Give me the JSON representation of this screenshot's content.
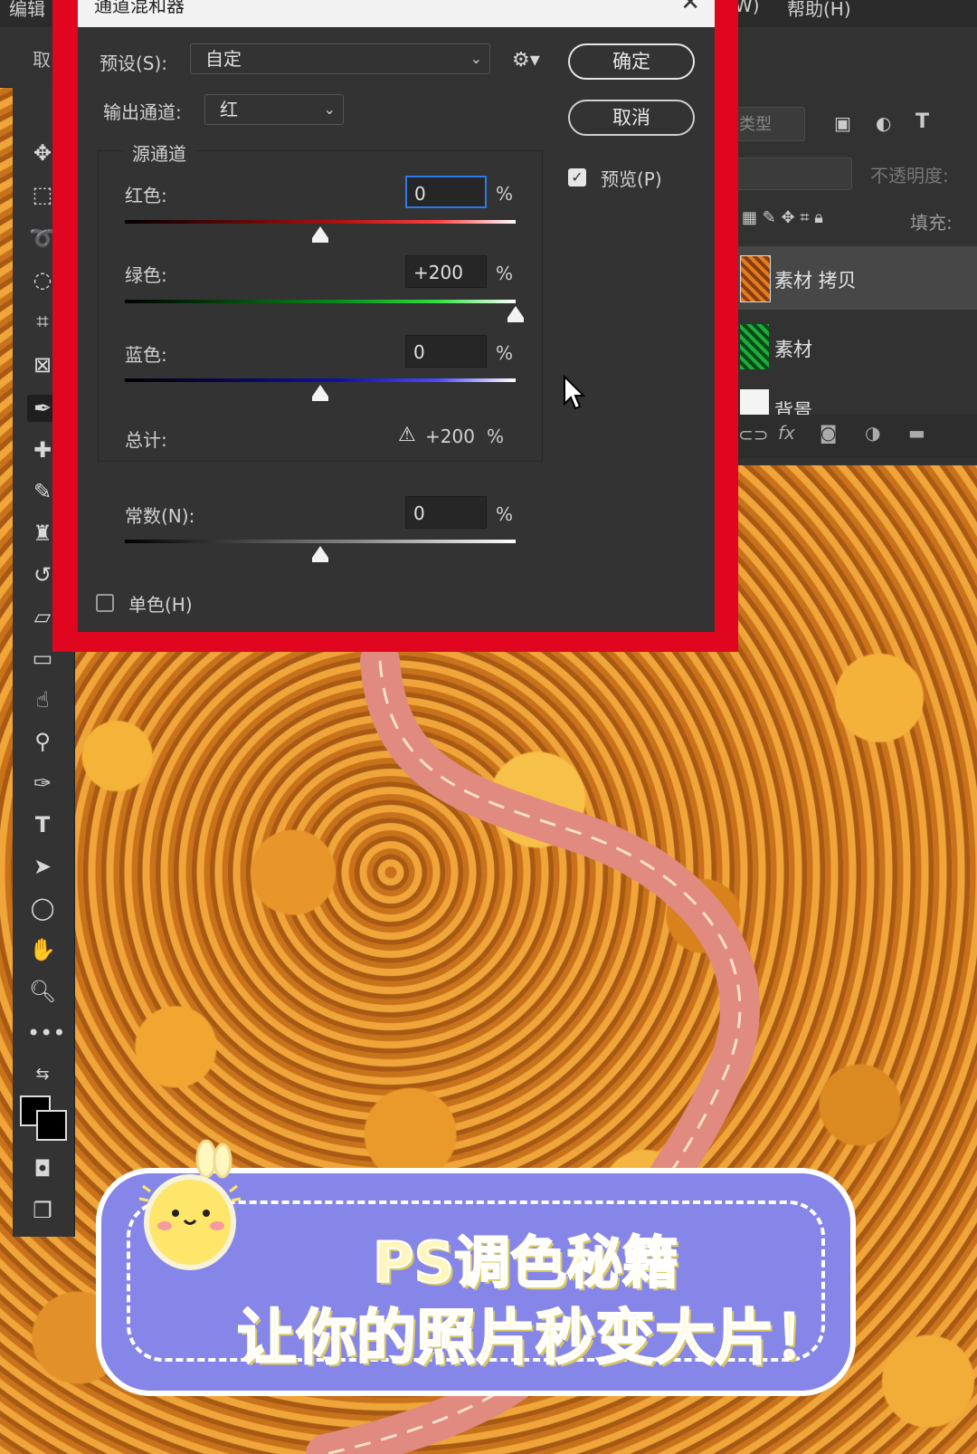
{
  "menubar": {
    "items": [
      "编辑",
      "W)",
      "帮助(H)"
    ]
  },
  "optbar": {
    "cancel_label": "取"
  },
  "dialog": {
    "title": "通道混和器",
    "preset_label": "预设(S):",
    "preset_value": "自定",
    "output_label": "输出通道:",
    "output_value": "红",
    "ok_label": "确定",
    "cancel_label": "取消",
    "preview_label": "预览(P)",
    "preview_checked": true,
    "source_group_label": "源通道",
    "channels": [
      {
        "label": "红色:",
        "value": "0",
        "slider": 0
      },
      {
        "label": "绿色:",
        "value": "+200",
        "slider": 200
      },
      {
        "label": "蓝色:",
        "value": "0",
        "slider": 0
      }
    ],
    "total_label": "总计:",
    "total_value": "+200",
    "constant_label": "常数(N):",
    "constant_value": "0",
    "constant_slider": 0,
    "percent": "%",
    "mono_label": "单色(H)",
    "mono_checked": false
  },
  "layers": {
    "opacity_label": "不透明度:",
    "fill_label": "填充:",
    "kind_label": "类型",
    "rows": [
      {
        "name": "素材 拷贝",
        "selected": true
      },
      {
        "name": "素材",
        "selected": false
      },
      {
        "name": "背景",
        "selected": false
      }
    ]
  },
  "banner": {
    "line1": "PS调色秘籍",
    "line2": "让你的照片秒变大片！"
  },
  "colors": {
    "frame": "#e0061f",
    "banner": "#8686e8",
    "accent_focus": "#2c7ae8"
  }
}
